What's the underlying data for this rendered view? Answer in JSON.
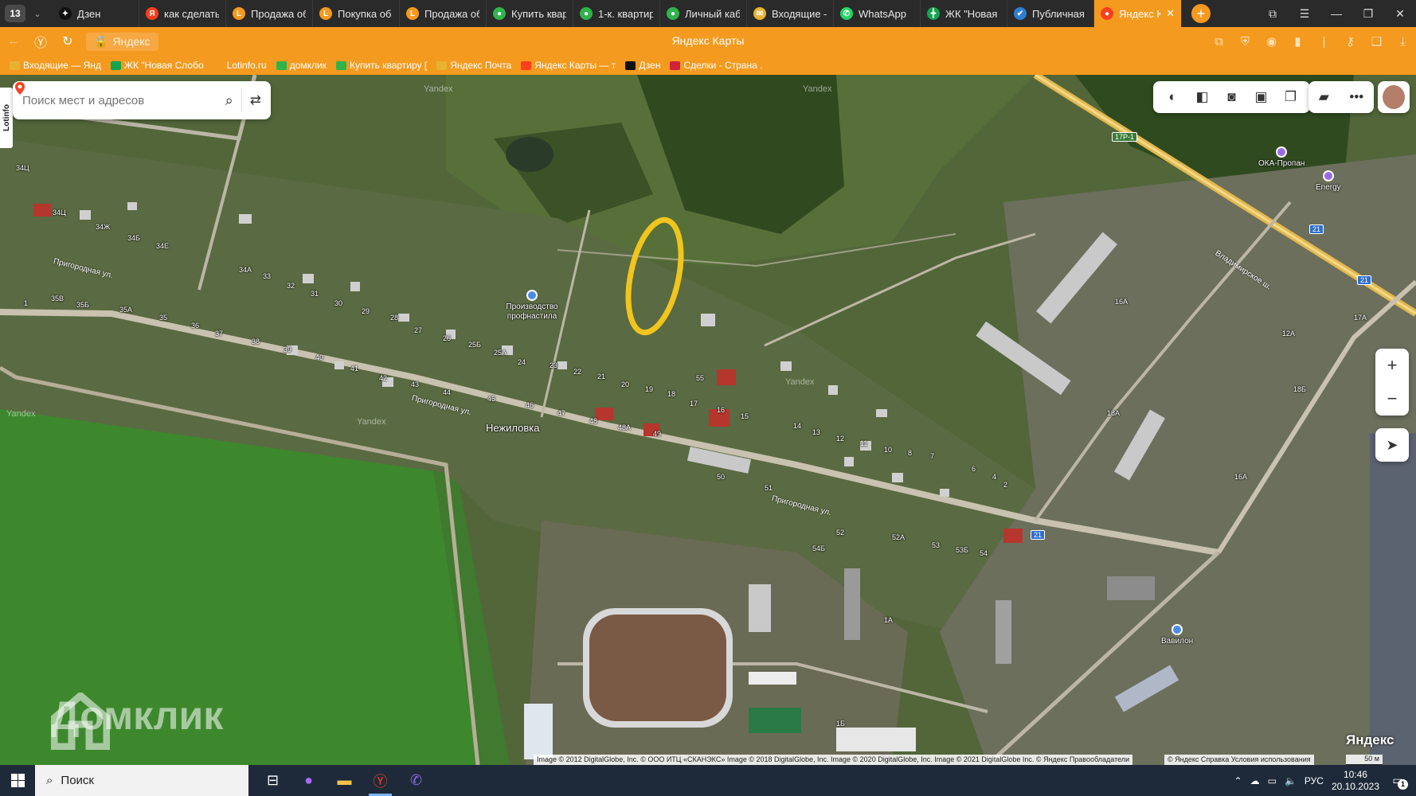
{
  "tabbar": {
    "counter": "13",
    "tabs": [
      {
        "title": "Дзен",
        "icon": "dzen-icon",
        "color": "#111111",
        "glyph": "✦"
      },
      {
        "title": "как сделать",
        "icon": "yandex-icon",
        "color": "#fc3f1d",
        "glyph": "Я"
      },
      {
        "title": "Продажа об",
        "icon": "lotinfo-icon",
        "color": "#f49a1f",
        "glyph": "L"
      },
      {
        "title": "Покупка об",
        "icon": "lotinfo-icon",
        "color": "#f49a1f",
        "glyph": "L"
      },
      {
        "title": "Продажа об",
        "icon": "lotinfo-icon",
        "color": "#f49a1f",
        "glyph": "L"
      },
      {
        "title": "Купить квар",
        "icon": "domclick-icon",
        "color": "#2fb34a",
        "glyph": "●"
      },
      {
        "title": "1-к. квартир",
        "icon": "domclick-icon",
        "color": "#2fb34a",
        "glyph": "●"
      },
      {
        "title": "Личный каб",
        "icon": "domclick-icon",
        "color": "#2fb34a",
        "glyph": "●"
      },
      {
        "title": "Входящие –",
        "icon": "mail-icon",
        "color": "#e8b230",
        "glyph": "✉"
      },
      {
        "title": "WhatsApp",
        "icon": "whatsapp-icon",
        "color": "#25d366",
        "glyph": "✆"
      },
      {
        "title": "ЖК \"Новая",
        "icon": "zhk-icon",
        "color": "#14a44d",
        "glyph": "╋"
      },
      {
        "title": "Публичная",
        "icon": "cadastral-icon",
        "color": "#2f7fd0",
        "glyph": "✔"
      }
    ],
    "active_tab": {
      "title": "Яндекс К",
      "icon": "yandex-maps-icon",
      "color": "#fc3f1d",
      "glyph": "●"
    }
  },
  "addressbar": {
    "url_text": "Яндекс",
    "page_title": "Яндекс Карты"
  },
  "bookmarks": [
    {
      "label": "Входящие — Янд",
      "color": "#e8b230"
    },
    {
      "label": "ЖК \"Новая Слобо",
      "color": "#14a44d"
    },
    {
      "label": "Lotinfo.ru",
      "color": "#f49a1f"
    },
    {
      "label": "домклик",
      "color": "#2fb34a"
    },
    {
      "label": "Купить квартиру [",
      "color": "#2fb34a"
    },
    {
      "label": "Яндекс Почта",
      "color": "#e8b230"
    },
    {
      "label": "Яндекс Карты — т",
      "color": "#fc3f1d"
    },
    {
      "label": "Дзен",
      "color": "#111111"
    },
    {
      "label": "Сделки - Страна .",
      "color": "#d0213a"
    }
  ],
  "map": {
    "search_placeholder": "Поиск мест и адресов",
    "lotinfo_tab": "Lotinfo",
    "village": "Нежиловка",
    "streets": [
      "Пригородная ул.",
      "Пригородная ул.",
      "Пригородная ул.",
      "Владимирское ш."
    ],
    "road_shield": "17Р-1",
    "route_badges": [
      "21",
      "21",
      "21"
    ],
    "pois": [
      {
        "name": "Производство профнастила"
      },
      {
        "name": "ОКА-Пропан"
      },
      {
        "name": "Energy"
      },
      {
        "name": "Вавилон"
      }
    ],
    "house_numbers": [
      "34Ц",
      "34Ц",
      "34Ж",
      "34Б",
      "34Е",
      "34А",
      "33",
      "32",
      "31",
      "30",
      "29",
      "28",
      "27",
      "26",
      "25Б",
      "25А",
      "24",
      "23",
      "22",
      "21",
      "20",
      "19",
      "18",
      "17",
      "16",
      "15",
      "14",
      "13",
      "12",
      "11",
      "10",
      "8",
      "7",
      "6",
      "4",
      "2",
      "1",
      "35В",
      "35Б",
      "35А",
      "35",
      "36",
      "37",
      "38",
      "39",
      "40",
      "41",
      "42",
      "43",
      "44",
      "45",
      "46",
      "47",
      "48",
      "48А",
      "49",
      "50",
      "51",
      "52",
      "52А",
      "53",
      "53Б",
      "54",
      "54Б",
      "55",
      "16А",
      "17А",
      "18Б",
      "18А",
      "16А",
      "1А",
      "1Б",
      "12А",
      "22",
      "16"
    ],
    "watermark_brand": "Домклик",
    "yandex_logo": "Яндекс",
    "yandex_watermark": "Yandex",
    "copyright": "Image © 2012 DigitalGlobe, Inc. © ООО ИТЦ «СКАНЭКС» Image © 2018 DigitalGlobe, Inc. Image © 2020 DigitalGlobe, Inc. Image © 2021 DigitalGlobe Inc. © Яндекс   Правообладатели",
    "terms": "© Яндекс   Справка   Условия использования",
    "scale": "50 м",
    "zoom_in": "+",
    "zoom_out": "−"
  },
  "taskbar": {
    "search_label": "Поиск",
    "lang": "РУС",
    "time": "10:46",
    "date": "20.10.2023",
    "notif_count": "1"
  }
}
